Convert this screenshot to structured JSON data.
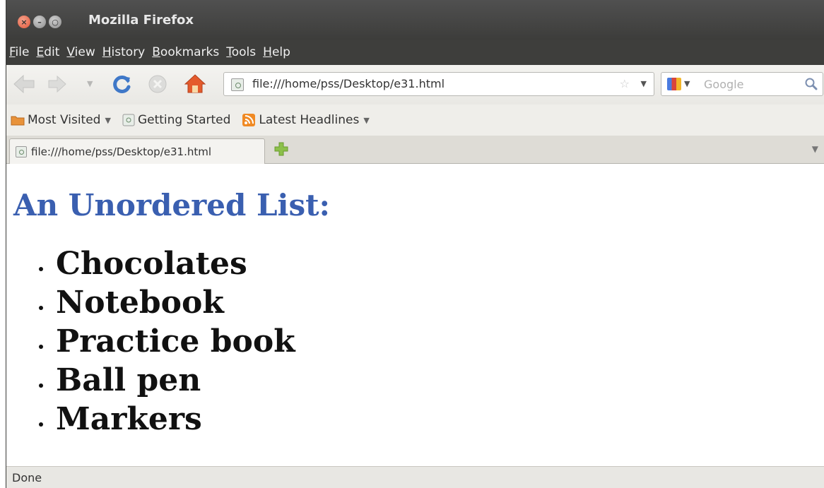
{
  "window": {
    "title": "Mozilla Firefox"
  },
  "menu": {
    "items": [
      "File",
      "Edit",
      "View",
      "History",
      "Bookmarks",
      "Tools",
      "Help"
    ]
  },
  "nav": {
    "url": "file:///home/pss/Desktop/e31.html",
    "search_placeholder": "Google"
  },
  "bookmarks": {
    "items": [
      "Most Visited",
      "Getting Started",
      "Latest Headlines"
    ]
  },
  "tabs": {
    "active_label": "file:///home/pss/Desktop/e31.html"
  },
  "page": {
    "heading": "An Unordered List:",
    "list": [
      "Chocolates",
      "Notebook",
      "Practice book",
      "Ball pen",
      "Markers"
    ]
  },
  "status": {
    "text": "Done"
  },
  "colors": {
    "heading": "#3a5fb0",
    "titlebar": "#3c3c3a",
    "close_button": "#e0583a"
  }
}
